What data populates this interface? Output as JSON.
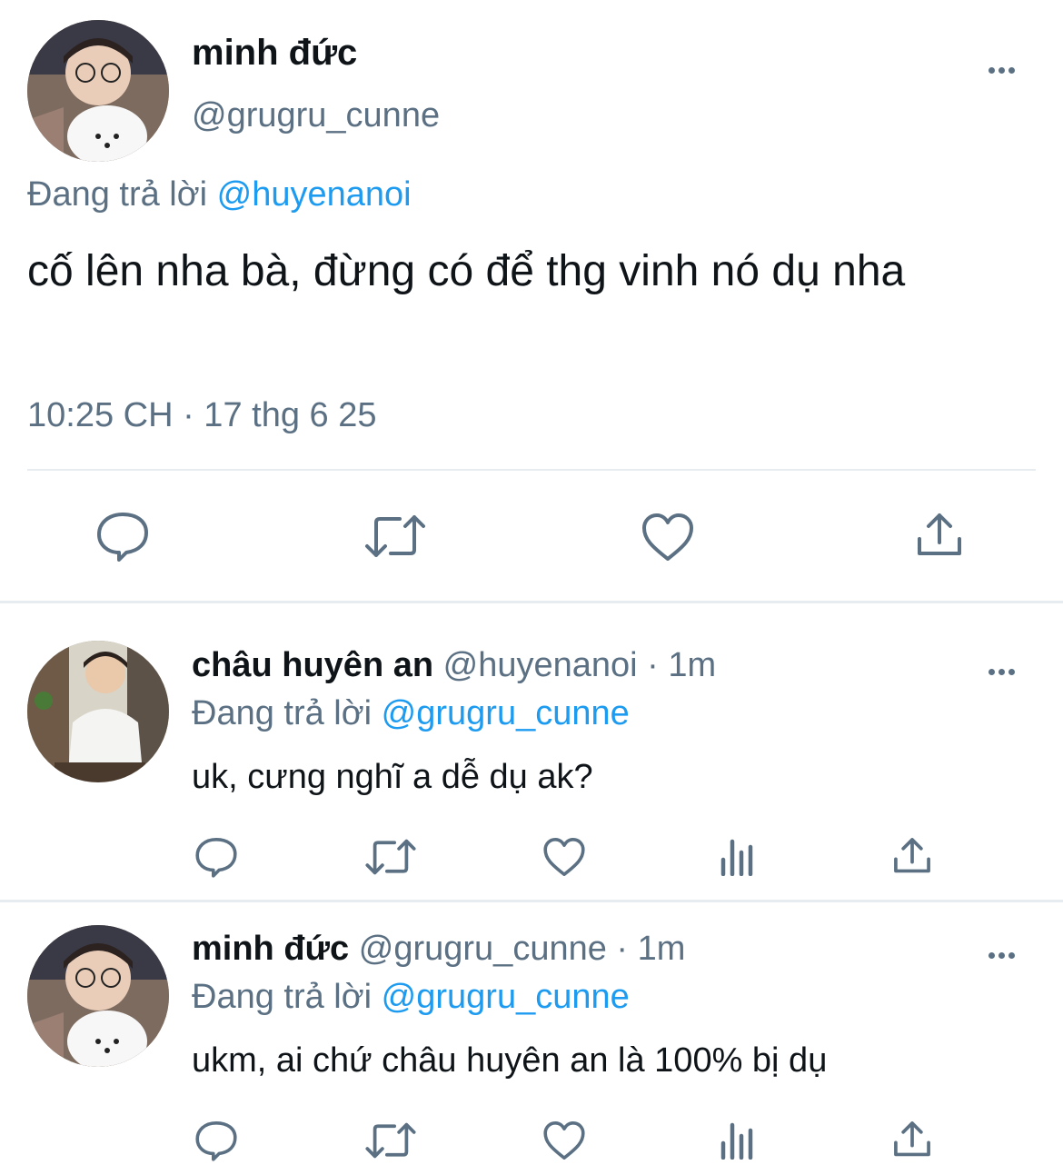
{
  "main_tweet": {
    "author_name": "minh đức",
    "handle": "@grugru_cunne",
    "replying_prefix": "Đang trả lời",
    "replying_to": "@huyenanoi",
    "text": "cố lên nha bà, đừng có để thg vinh nó dụ nha",
    "timestamp": "10:25 CH · 17 thg 6 25",
    "actions": [
      "reply-icon",
      "retweet-icon",
      "like-icon",
      "share-icon"
    ]
  },
  "replies": [
    {
      "author_name": "châu huyên an",
      "handle": "@huyenanoi",
      "time": "· 1m",
      "replying_prefix": "Đang trả lời",
      "replying_to": "@grugru_cunne",
      "text": "uk, cưng nghĩ a dễ dụ ak?",
      "actions": [
        "reply-icon",
        "retweet-icon",
        "like-icon",
        "analytics-icon",
        "share-icon"
      ]
    },
    {
      "author_name": "minh đức",
      "handle": "@grugru_cunne",
      "time": "· 1m",
      "replying_prefix": "Đang trả lời",
      "replying_to": "@grugru_cunne",
      "text": "ukm, ai chứ châu huyên an là 100% bị dụ",
      "actions": [
        "reply-icon",
        "retweet-icon",
        "like-icon",
        "analytics-icon",
        "share-icon"
      ]
    }
  ],
  "colors": {
    "text": "#0f1419",
    "secondary": "#5b7083",
    "accent": "#1d9bf0",
    "divider": "#e6ecf0"
  }
}
